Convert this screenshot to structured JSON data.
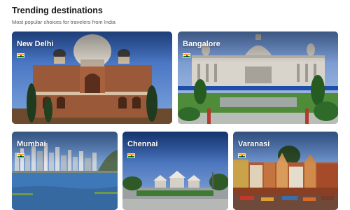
{
  "header": {
    "title": "Trending destinations",
    "subtitle": "Most popular choices for travelers from India"
  },
  "destinations": [
    {
      "name": "New Delhi",
      "flag": "india-flag-icon"
    },
    {
      "name": "Bangalore",
      "flag": "india-flag-icon"
    },
    {
      "name": "Mumbai",
      "flag": "india-flag-icon"
    },
    {
      "name": "Chennai",
      "flag": "india-flag-icon"
    },
    {
      "name": "Varanasi",
      "flag": "india-flag-icon"
    }
  ],
  "colors": {
    "flag_saffron": "#ff9933",
    "flag_white": "#ffffff",
    "flag_green": "#138808",
    "chakra_blue": "#000080"
  }
}
